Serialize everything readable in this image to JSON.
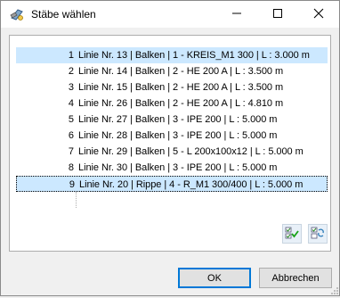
{
  "window": {
    "title": "Stäbe wählen",
    "icon": "members-select-icon",
    "controls": [
      "minimize-icon",
      "maximize-icon",
      "close-icon"
    ]
  },
  "list": {
    "items": [
      {
        "num": "1",
        "text": "Linie Nr. 13 | Balken | 1 - KREIS_M1 300 | L : 3.000 m",
        "selected": true
      },
      {
        "num": "2",
        "text": "Linie Nr. 14 | Balken | 2 - HE 200 A | L : 3.500 m",
        "selected": false
      },
      {
        "num": "3",
        "text": "Linie Nr. 15 | Balken | 2 - HE 200 A | L : 3.500 m",
        "selected": false
      },
      {
        "num": "4",
        "text": "Linie Nr. 26 | Balken | 2 - HE 200 A | L : 4.810 m",
        "selected": false
      },
      {
        "num": "5",
        "text": "Linie Nr. 27 | Balken | 3 - IPE 200 | L : 5.000 m",
        "selected": false
      },
      {
        "num": "6",
        "text": "Linie Nr. 28 | Balken | 3 - IPE 200 | L : 5.000 m",
        "selected": false
      },
      {
        "num": "7",
        "text": "Linie Nr. 29 | Balken | 5 - L 200x100x12 | L : 5.000 m",
        "selected": false
      },
      {
        "num": "8",
        "text": "Linie Nr. 30 | Balken | 3 - IPE 200 | L : 5.000 m",
        "selected": false
      },
      {
        "num": "9",
        "text": "Linie Nr. 20 | Rippe | 4 - R_M1 300/400 | L : 5.000 m",
        "selected": true,
        "focused": true
      }
    ],
    "select_all_icon": "select-all-icon",
    "invert_selection_icon": "invert-selection-icon"
  },
  "buttons": {
    "ok": "OK",
    "cancel": "Abbrechen"
  },
  "colors": {
    "selection": "#cce8ff",
    "focus_border": "#0078d7"
  }
}
